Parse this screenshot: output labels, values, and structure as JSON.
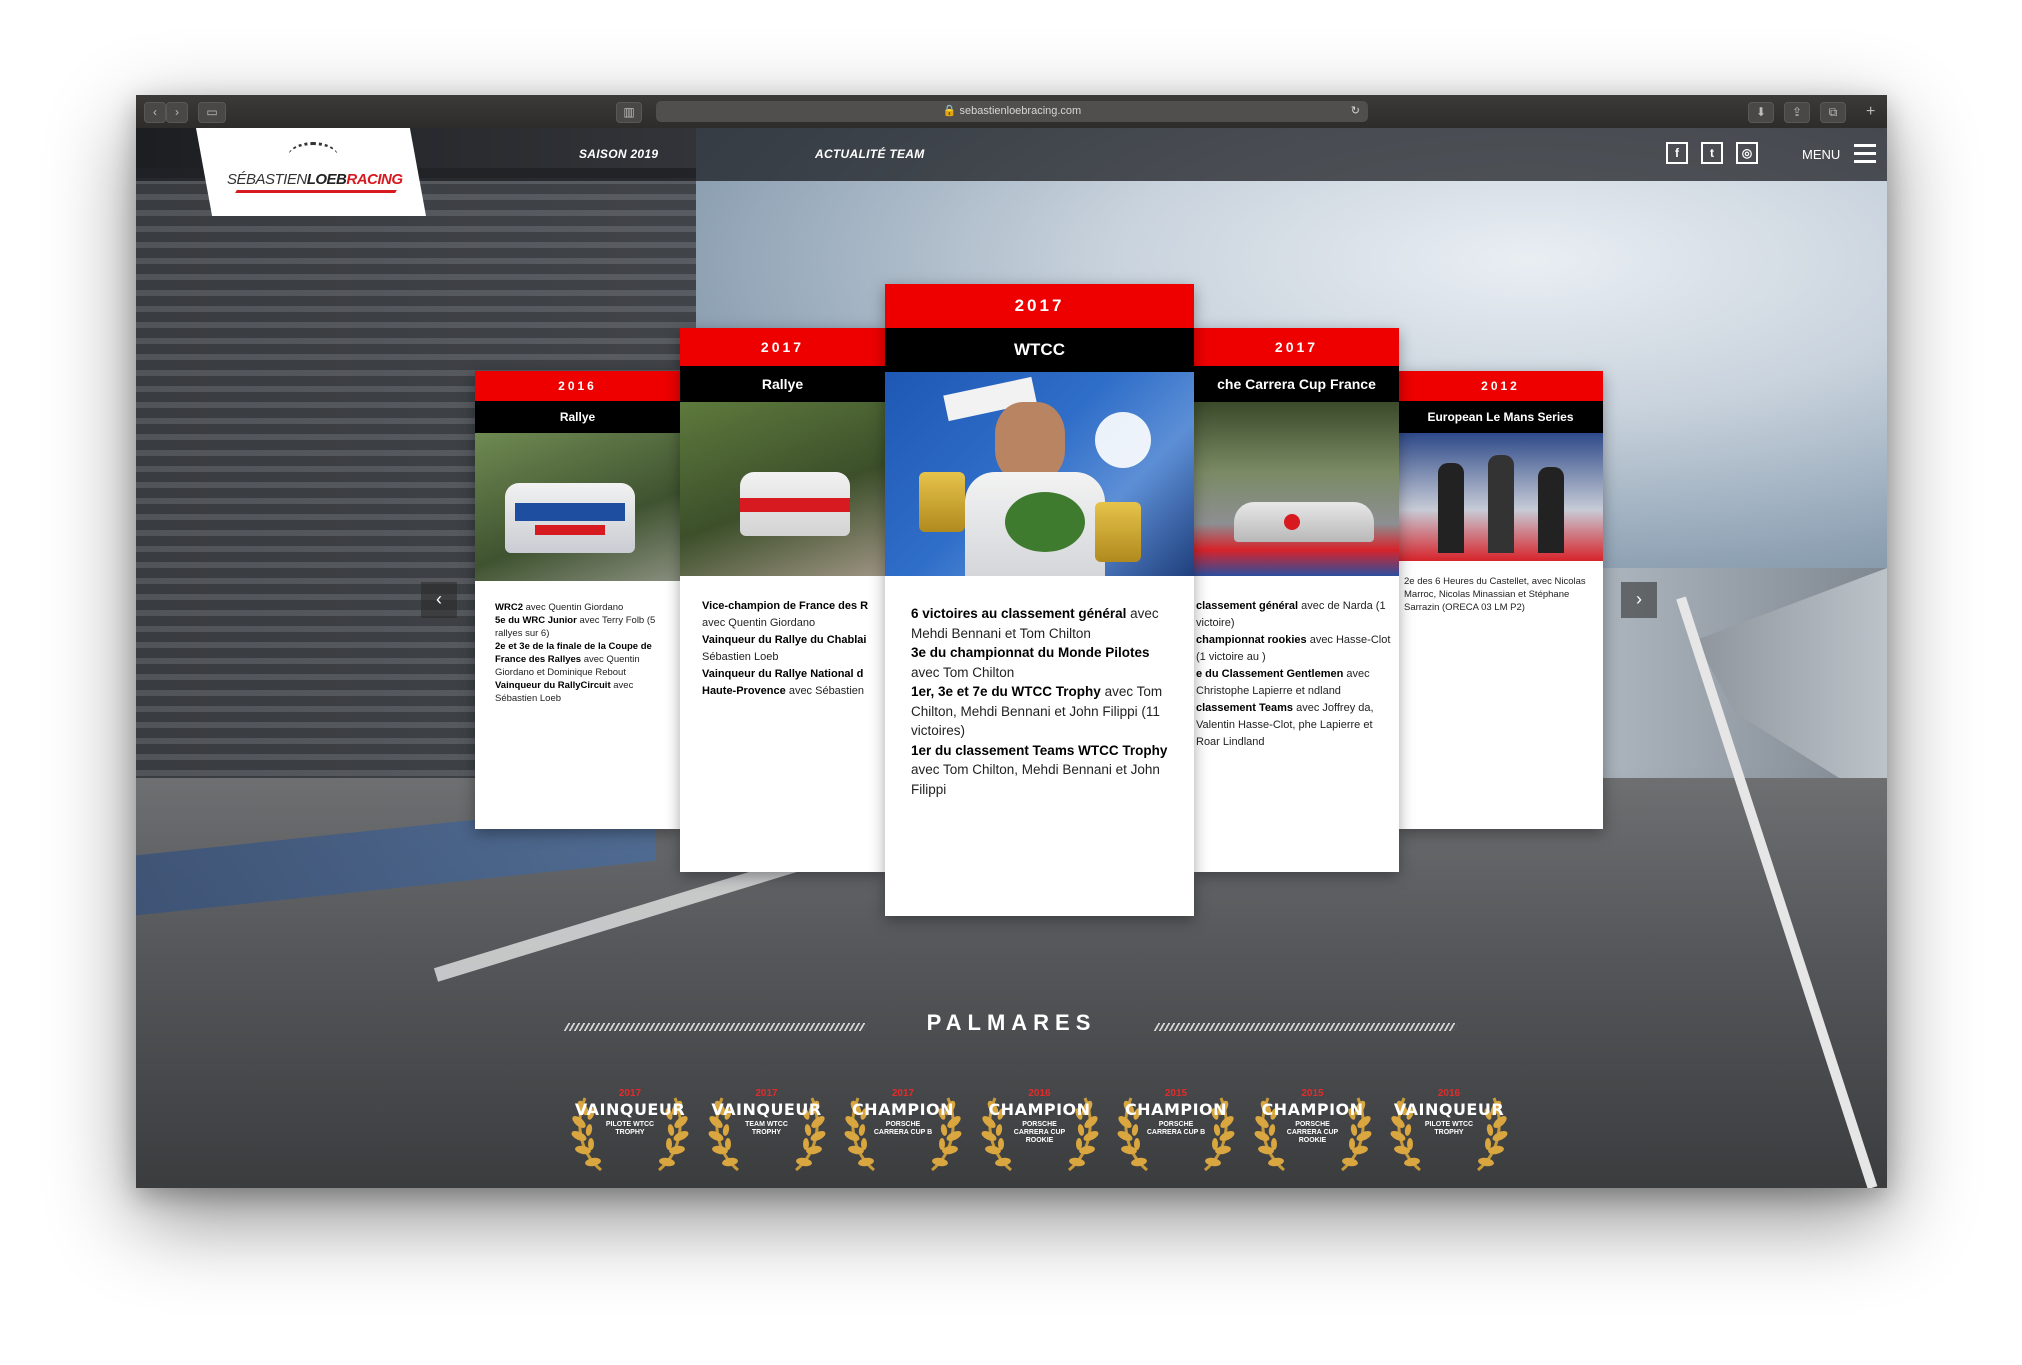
{
  "browser": {
    "url": "sebastienloebracing.com"
  },
  "brand": {
    "logo_first": "SÉBASTIEN",
    "logo_mid": "LOEB",
    "logo_last": "RACING"
  },
  "nav": {
    "saison": "SAISON 2019",
    "actualite": "ACTUALITÉ TEAM",
    "menu": "MENU"
  },
  "social": {
    "facebook": "f",
    "twitter": "t",
    "instagram": "◎"
  },
  "colors": {
    "accent_red": "#ee0000",
    "header_black": "#000000"
  },
  "cards": [
    {
      "year": "2016",
      "category": "Rallye",
      "lines": [
        {
          "b": "WRC2",
          "t": " avec Quentin Giordano"
        },
        {
          "b": "5e du WRC Junior",
          "t": " avec Terry Folb (5 rallyes sur 6)"
        },
        {
          "b": "2e et 3e de la finale de la Coupe de France des Rallyes",
          "t": " avec Quentin Giordano et Dominique Rebout"
        },
        {
          "b": "Vainqueur du RallyCircuit",
          "t": " avec Sébastien Loeb"
        }
      ]
    },
    {
      "year": "2017",
      "category": "Rallye",
      "lines": [
        {
          "b": "Vice-champion de France des R",
          "t": " avec Quentin Giordano"
        },
        {
          "b": "Vainqueur du Rallye du Chablai",
          "t": " Sébastien Loeb"
        },
        {
          "b": "Vainqueur du Rallye National d Haute-Provence",
          "t": " avec Sébastien"
        }
      ]
    },
    {
      "year": "2017",
      "category": "WTCC",
      "lines": [
        {
          "b": "6 victoires au classement général",
          "t": " avec Mehdi Bennani et Tom Chilton"
        },
        {
          "b": "3e du championnat du Monde Pilotes",
          "t": " avec Tom Chilton"
        },
        {
          "b": "1er, 3e et 7e du WTCC Trophy",
          "t": " avec Tom Chilton, Mehdi Bennani et John Filippi (11 victoires)"
        },
        {
          "b": "1er du classement Teams WTCC Trophy",
          "t": " avec Tom Chilton, Mehdi Bennani et John Filippi"
        }
      ]
    },
    {
      "year": "2017",
      "category": "che Carrera Cup France",
      "lines": [
        {
          "b": "classement général",
          "t": " avec de Narda (1 victoire)"
        },
        {
          "b": "championnat rookies",
          "t": " avec Hasse-Clot (1 victoire au )"
        },
        {
          "b": "e du Classement Gentlemen",
          "t": " avec Christophe Lapierre et ndland"
        },
        {
          "b": "classement Teams",
          "t": " avec Joffrey da, Valentin Hasse-Clot, phe Lapierre et Roar Lindland"
        }
      ]
    },
    {
      "year": "2012",
      "category": "European Le Mans Series",
      "lines": [
        {
          "b": "",
          "t": "2e des 6 Heures du Castellet, avec Nicolas Marroc, Nicolas Minassian et Stéphane Sarrazin (ORECA 03 LM P2)"
        }
      ]
    }
  ],
  "palmares": {
    "title": "PALMARES",
    "awards": [
      {
        "year": "2017",
        "title": "VAINQUEUR",
        "sub": "PILOTE WTCC TROPHY"
      },
      {
        "year": "2017",
        "title": "VAINQUEUR",
        "sub": "TEAM WTCC TROPHY"
      },
      {
        "year": "2017",
        "title": "CHAMPION",
        "sub": "PORSCHE CARRERA CUP B"
      },
      {
        "year": "2016",
        "title": "CHAMPION",
        "sub": "PORSCHE CARRERA CUP ROOKIE"
      },
      {
        "year": "2015",
        "title": "CHAMPION",
        "sub": "PORSCHE CARRERA CUP B"
      },
      {
        "year": "2015",
        "title": "CHAMPION",
        "sub": "PORSCHE CARRERA CUP ROOKIE"
      },
      {
        "year": "2016",
        "title": "VAINQUEUR",
        "sub": "PILOTE WTCC TROPHY"
      }
    ]
  }
}
